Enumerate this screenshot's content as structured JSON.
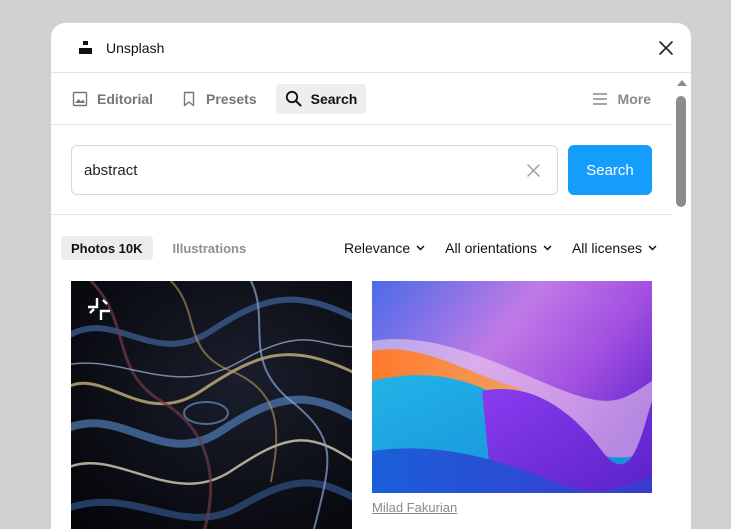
{
  "titlebar": {
    "title": "Unsplash"
  },
  "tabs": [
    {
      "label": "Editorial",
      "icon": "image-icon"
    },
    {
      "label": "Presets",
      "icon": "bookmark-icon"
    },
    {
      "label": "Search",
      "icon": "search-icon"
    }
  ],
  "more": {
    "label": "More",
    "icon": "menu-icon"
  },
  "search": {
    "value": "abstract",
    "button_label": "Search"
  },
  "filters": {
    "photos_label": "Photos 10K",
    "illustrations_label": "Illustrations",
    "sort_label": "Relevance",
    "orientation_label": "All orientations",
    "license_label": "All licenses"
  },
  "results": [
    {
      "badge": "unsplash-plus-icon"
    },
    {
      "credit": "Milad Fakurian"
    }
  ],
  "colors": {
    "accent": "#149dfb",
    "tab_active_bg": "#eeeeee"
  }
}
